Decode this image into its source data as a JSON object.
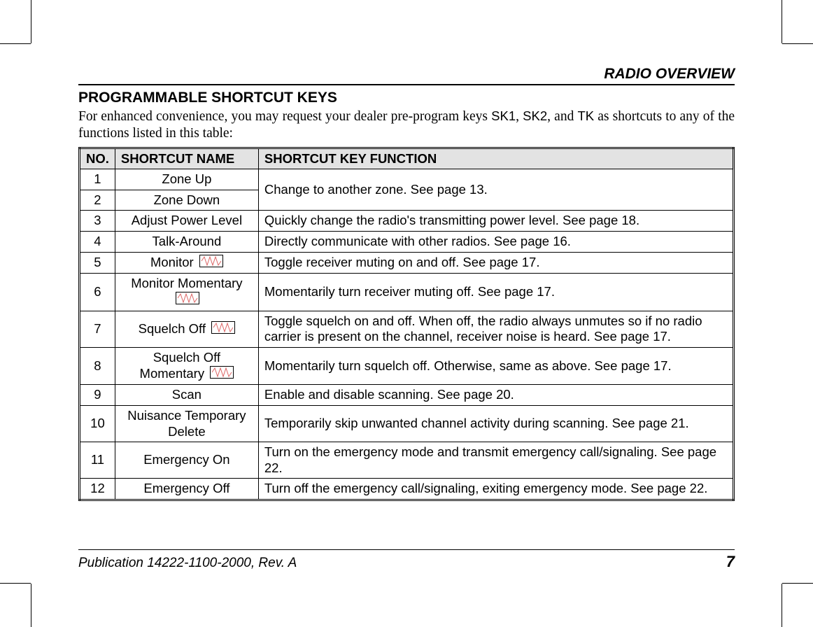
{
  "header": {
    "running": "RADIO OVERVIEW"
  },
  "section": {
    "title": "PROGRAMMABLE SHORTCUT KEYS",
    "intro_pre": "For enhanced convenience, you may request your dealer pre-program keys ",
    "k1": "SK1",
    "comma1": ", ",
    "k2": "SK2",
    "mid": ", and ",
    "k3": "TK",
    "intro_post": " as shortcuts to any of the functions listed in this table:"
  },
  "table": {
    "headers": {
      "no": "NO.",
      "name": "SHORTCUT NAME",
      "func": "SHORTCUT KEY FUNCTION"
    },
    "rows": [
      {
        "no": "1",
        "name": "Zone Up",
        "func": "Change to another zone. See page 13.",
        "merge_func_with_next": true
      },
      {
        "no": "2",
        "name": "Zone Down",
        "func": ""
      },
      {
        "no": "3",
        "name": "Adjust Power Level",
        "func": "Quickly change the radio's transmitting power level. See page 18."
      },
      {
        "no": "4",
        "name": "Talk-Around",
        "func": "Directly communicate with other radios. See page 16."
      },
      {
        "no": "5",
        "name": "Monitor",
        "icon": true,
        "func": "Toggle receiver muting on and off. See page 17."
      },
      {
        "no": "6",
        "name": "Monitor Momentary",
        "icon": true,
        "func": "Momentarily turn receiver muting off.  See page 17."
      },
      {
        "no": "7",
        "name": "Squelch Off",
        "icon": true,
        "func": "Toggle squelch on and off. When off, the radio always unmutes so if no radio carrier is present on the channel, receiver noise is heard. See page 17."
      },
      {
        "no": "8",
        "name": "Squelch Off Momentary",
        "icon": true,
        "func": "Momentarily turn squelch off. Otherwise, same as above. See page 17."
      },
      {
        "no": "9",
        "name": "Scan",
        "func": "Enable and disable scanning. See page 20."
      },
      {
        "no": "10",
        "name": "Nuisance Temporary Delete",
        "func": "Temporarily skip unwanted channel activity during scanning. See page 21."
      },
      {
        "no": "11",
        "name": "Emergency On",
        "func": "Turn on the emergency mode and transmit emergency call/signaling. See page 22."
      },
      {
        "no": "12",
        "name": "Emergency Off",
        "func": "Turn off the emergency call/signaling, exiting emergency mode. See page 22."
      }
    ]
  },
  "footer": {
    "pub": "Publication 14222-1100-2000, Rev. A",
    "page": "7"
  }
}
